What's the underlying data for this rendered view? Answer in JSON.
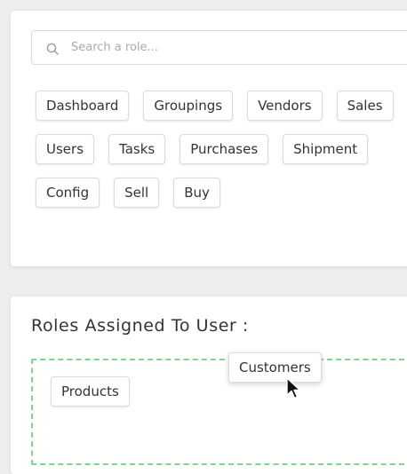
{
  "search": {
    "placeholder": "Search a role...",
    "value": ""
  },
  "available_roles": {
    "rows": [
      [
        "Dashboard",
        "Groupings",
        "Vendors",
        "Sales"
      ],
      [
        "Users",
        "Tasks",
        "Purchases",
        "Shipment"
      ],
      [
        "Config",
        "Sell",
        "Buy"
      ]
    ]
  },
  "assigned_section": {
    "title": "Roles Assigned To User :",
    "roles": [
      "Products"
    ]
  },
  "dragging": {
    "label": "Customers"
  },
  "colors": {
    "dropzone_border": "#7fd68a",
    "chip_border": "#dcdcdc",
    "background": "#eeeeee"
  },
  "icons": {
    "search": "search-icon",
    "cursor": "mouse-pointer-icon"
  }
}
